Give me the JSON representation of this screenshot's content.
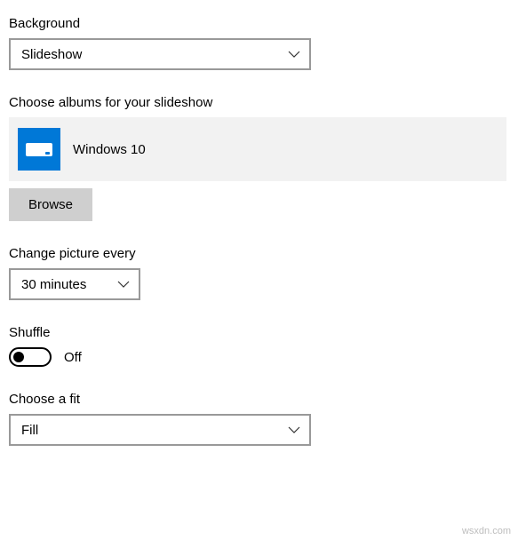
{
  "background": {
    "label": "Background",
    "value": "Slideshow"
  },
  "albums": {
    "label": "Choose albums for your slideshow",
    "item_name": "Windows 10",
    "browse_label": "Browse"
  },
  "interval": {
    "label": "Change picture every",
    "value": "30 minutes"
  },
  "shuffle": {
    "label": "Shuffle",
    "state_label": "Off"
  },
  "fit": {
    "label": "Choose a fit",
    "value": "Fill"
  },
  "watermark": "wsxdn.com"
}
